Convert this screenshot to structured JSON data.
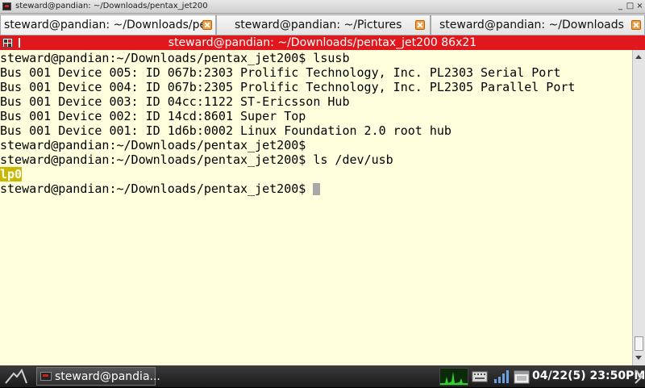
{
  "window": {
    "title": "steward@pandian: ~/Downloads/pentax_jet200",
    "controls": {
      "minimize": "_",
      "maximize": "□",
      "close": "×"
    }
  },
  "tabs": [
    {
      "label": "steward@pandian: ~/Downloads/pe",
      "active": true
    },
    {
      "label": "steward@pandian: ~/Pictures",
      "active": false
    },
    {
      "label": "steward@pandian: ~/Downloads",
      "active": false
    }
  ],
  "terminal_header": {
    "title": "steward@pandian: ~/Downloads/pentax_jet200 86x21"
  },
  "terminal": {
    "lines": [
      "steward@pandian:~/Downloads/pentax_jet200$ lsusb",
      "Bus 001 Device 005: ID 067b:2303 Prolific Technology, Inc. PL2303 Serial Port",
      "Bus 001 Device 004: ID 067b:2305 Prolific Technology, Inc. PL2305 Parallel Port",
      "Bus 001 Device 003: ID 04cc:1122 ST-Ericsson Hub",
      "Bus 001 Device 002: ID 14cd:8601 Super Top",
      "Bus 001 Device 001: ID 1d6b:0002 Linux Foundation 2.0 root hub",
      "steward@pandian:~/Downloads/pentax_jet200$",
      "steward@pandian:~/Downloads/pentax_jet200$ ls /dev/usb",
      "lp0",
      "steward@pandian:~/Downloads/pentax_jet200$ "
    ],
    "background": "#ffffdd",
    "highlight_color": "#c8b800"
  },
  "taskbar": {
    "task_label": "steward@pandia...",
    "clock": "04/22(5) 23:50PM"
  },
  "colors": {
    "status_bar": "#e0181d",
    "tab_close": "#f0a040"
  }
}
